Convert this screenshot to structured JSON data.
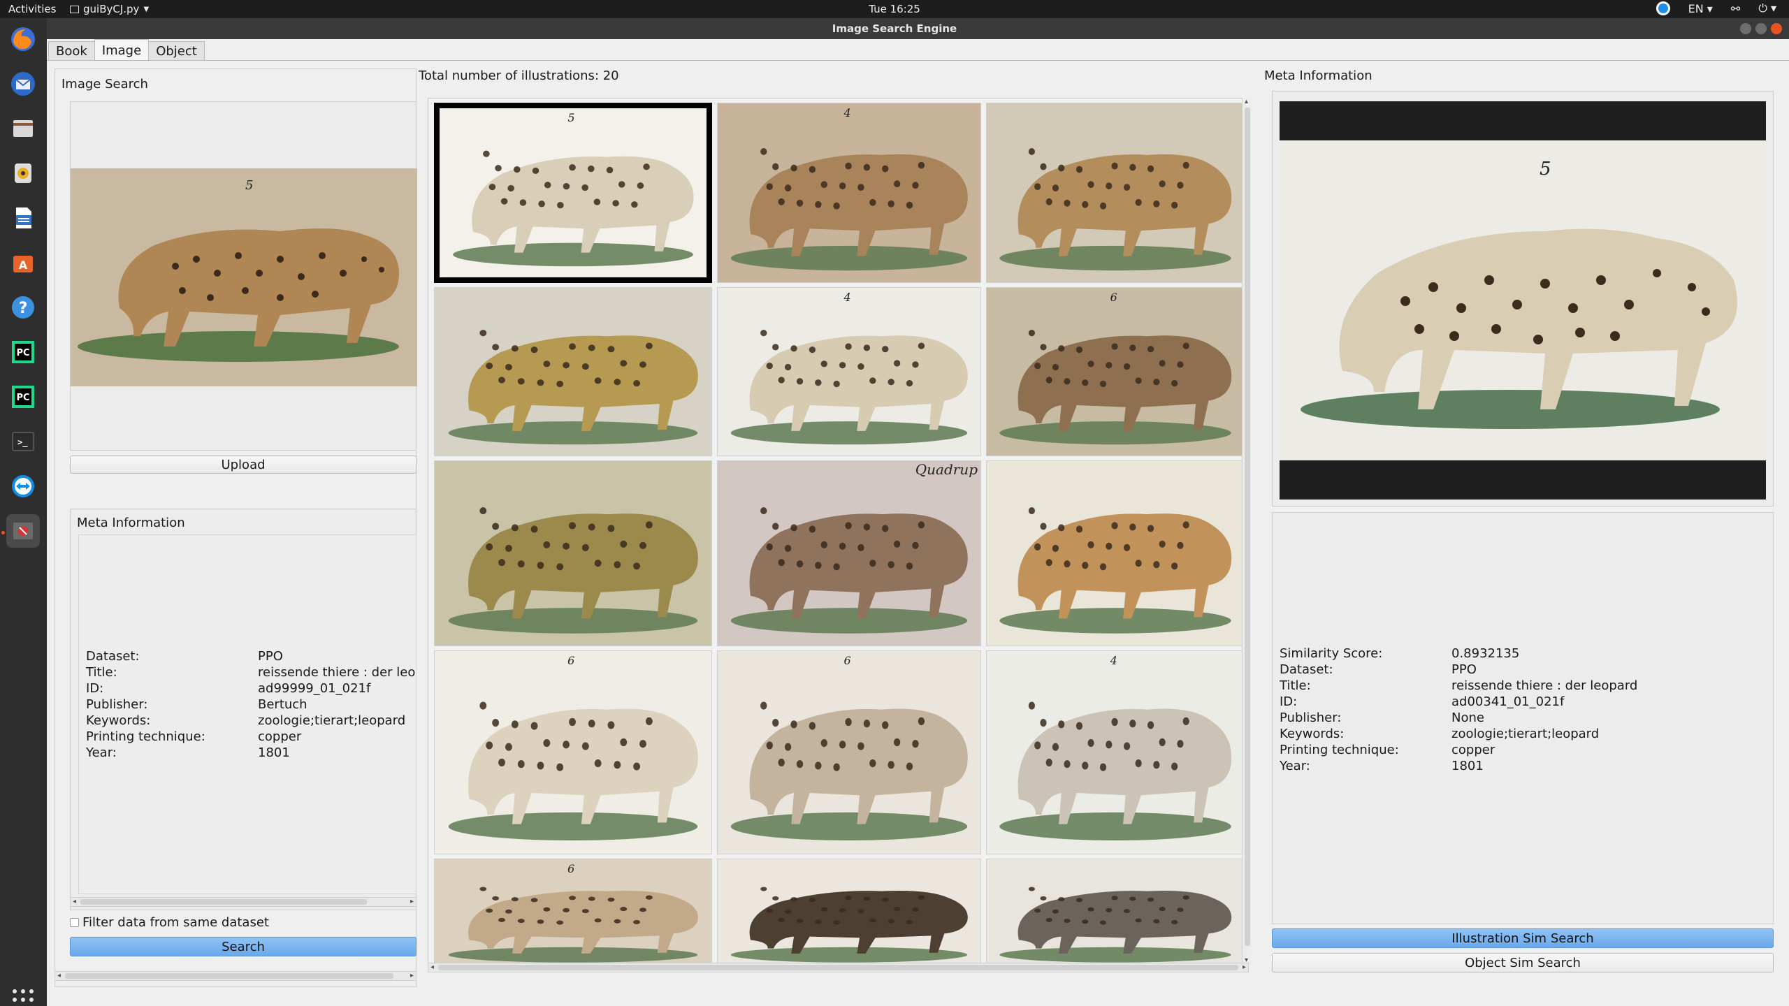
{
  "system_bar": {
    "activities": "Activities",
    "app_menu": "guiByCJ.py",
    "clock": "Tue 16:25",
    "language": "EN"
  },
  "window": {
    "title": "Image Search Engine"
  },
  "tabs": [
    {
      "label": "Book",
      "active": false
    },
    {
      "label": "Image",
      "active": true
    },
    {
      "label": "Object",
      "active": false
    }
  ],
  "left_panel": {
    "group_title": "Image Search",
    "upload_label": "Upload",
    "meta_title": "Meta Information",
    "meta": [
      {
        "key": "Dataset:",
        "value": "PPO"
      },
      {
        "key": "Title:",
        "value": "reissende thiere : der leo"
      },
      {
        "key": "ID:",
        "value": "ad99999_01_021f"
      },
      {
        "key": "Publisher:",
        "value": "Bertuch"
      },
      {
        "key": "Keywords:",
        "value": "zoologie;tierart;leopard"
      },
      {
        "key": "Printing technique:",
        "value": "copper"
      },
      {
        "key": "Year:",
        "value": "1801"
      }
    ],
    "filter_label": "Filter data from same dataset",
    "filter_checked": false,
    "search_label": "Search"
  },
  "center_panel": {
    "total_label": "Total number of illustrations: 20",
    "plate_numbers": [
      "5",
      "4",
      "",
      "",
      "4",
      "6",
      "",
      "",
      "",
      "6",
      "6",
      "4",
      "6",
      "",
      ""
    ],
    "plate_text": [
      "",
      "",
      "",
      "",
      "",
      "",
      "",
      "Quadrup",
      "",
      "",
      "",
      "",
      "",
      "",
      ""
    ]
  },
  "right_panel": {
    "group_title": "Meta Information",
    "plate_number": "5",
    "meta": [
      {
        "key": "Similarity Score:",
        "value": "0.8932135"
      },
      {
        "key": "Dataset:",
        "value": "PPO"
      },
      {
        "key": "Title:",
        "value": "reissende thiere : der leopard"
      },
      {
        "key": "ID:",
        "value": "ad00341_01_021f"
      },
      {
        "key": "Publisher:",
        "value": "None"
      },
      {
        "key": "Keywords:",
        "value": "zoologie;tierart;leopard"
      },
      {
        "key": "Printing technique:",
        "value": "copper"
      },
      {
        "key": "Year:",
        "value": "1801"
      }
    ],
    "illustration_sim_label": "Illustration Sim Search",
    "object_sim_label": "Object Sim Search"
  },
  "colors": {
    "accent": "#6aa8ea",
    "selected_border": "#000000",
    "dock_bg": "#2e2e2e",
    "topbar_bg": "#1d1d1d"
  }
}
